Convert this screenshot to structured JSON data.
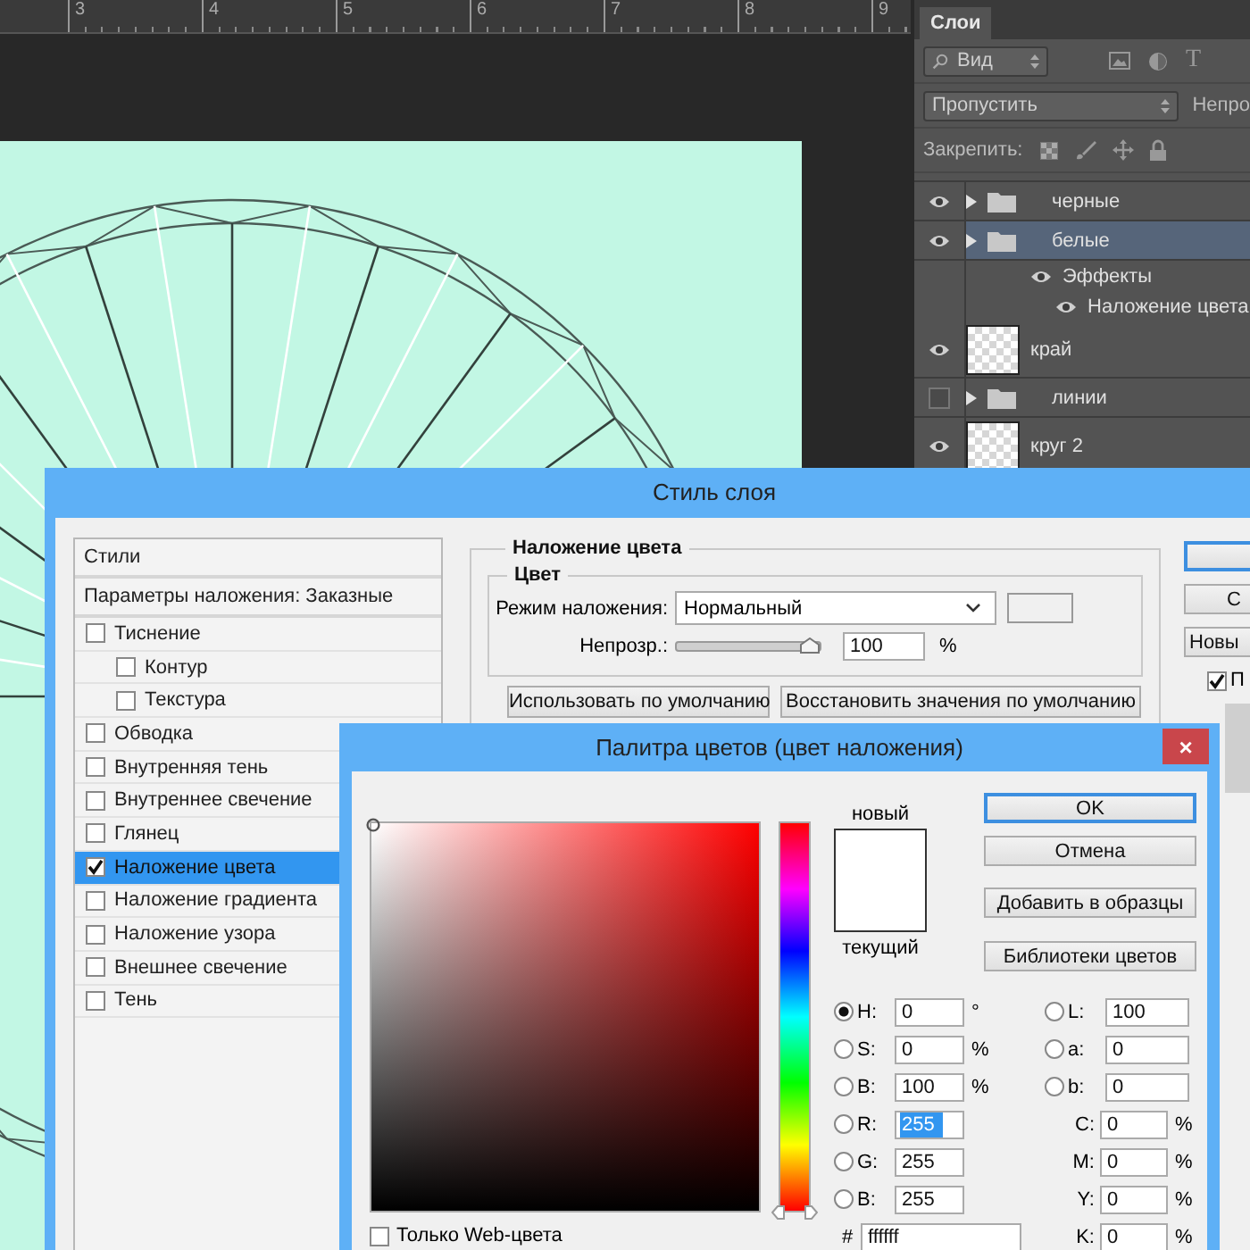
{
  "ruler": {
    "ticks": [
      "3",
      "4",
      "5",
      "6",
      "7",
      "8",
      "9"
    ]
  },
  "layers_panel": {
    "tab": "Слои",
    "filter": "Вид",
    "type_filter": "T",
    "blend_mode": "Пропустить",
    "opacity_label": "Непро",
    "lock_label": "Закрепить:",
    "layers": [
      {
        "kind": "group",
        "name": "черные",
        "visible": true,
        "selected": false
      },
      {
        "kind": "group",
        "name": "белые",
        "visible": true,
        "selected": true,
        "children": [
          {
            "kind": "effects",
            "name": "Эффекты",
            "visible": true,
            "children": [
              {
                "kind": "effects",
                "name": "Наложение цвета",
                "visible": true
              }
            ]
          }
        ]
      },
      {
        "kind": "layer",
        "name": "край",
        "visible": true,
        "selected": false
      },
      {
        "kind": "group",
        "name": "линии",
        "visible": false,
        "selected": false
      },
      {
        "kind": "layer",
        "name": "круг 2",
        "visible": true,
        "selected": false
      }
    ]
  },
  "layer_style": {
    "title": "Стиль слоя",
    "styles_header": "Стили",
    "blending_options": "Параметры наложения: Заказные",
    "styles": [
      {
        "label": "Тиснение",
        "checked": false,
        "selected": false,
        "children": [
          {
            "label": "Контур",
            "checked": false,
            "selected": false
          },
          {
            "label": "Текстура",
            "checked": false,
            "selected": false
          }
        ]
      },
      {
        "label": "Обводка",
        "checked": false,
        "selected": false
      },
      {
        "label": "Внутренняя тень",
        "checked": false,
        "selected": false
      },
      {
        "label": "Внутреннее свечение",
        "checked": false,
        "selected": false
      },
      {
        "label": "Глянец",
        "checked": false,
        "selected": false
      },
      {
        "label": "Наложение цвета",
        "checked": true,
        "selected": true
      },
      {
        "label": "Наложение градиента",
        "checked": false,
        "selected": false
      },
      {
        "label": "Наложение узора",
        "checked": false,
        "selected": false
      },
      {
        "label": "Внешнее свечение",
        "checked": false,
        "selected": false
      },
      {
        "label": "Тень",
        "checked": false,
        "selected": false
      }
    ],
    "section_title": "Наложение цвета",
    "group_title": "Цвет",
    "blend_mode_label": "Режим наложения:",
    "blend_mode": "Нормальный",
    "opacity_label": "Непрозр.:",
    "opacity": {
      "level": 1
    },
    "opacity_value": "100",
    "opacity_unit": "%",
    "buttons": [
      "Использовать по умолчанию",
      "Восстановить значения по умолчанию"
    ],
    "side_buttons": [
      {
        "default": true
      },
      {
        "label": "С",
        "default": false
      },
      {
        "label": "Новы",
        "default": false
      }
    ],
    "side_checkbox": {
      "label": "П",
      "checked": true
    }
  },
  "color_picker": {
    "title": "Палитра цветов (цвет наложения)",
    "close": "×",
    "new_label": "новый",
    "current_label": "текущий",
    "hue": {
      "level": 0
    },
    "buttons": [
      {
        "label": "OK",
        "default": true
      },
      {
        "label": "Отмена",
        "default": false
      },
      {
        "label": "Добавить в образцы",
        "default": false
      },
      {
        "label": "Библиотеки цветов",
        "default": false
      }
    ],
    "hsb": [
      {
        "label": "H:",
        "value": "0",
        "unit": "°",
        "selected": true
      },
      {
        "label": "S:",
        "value": "0",
        "unit": "%",
        "selected": false
      },
      {
        "label": "B:",
        "value": "100",
        "unit": "%",
        "selected": false
      }
    ],
    "rgb": [
      {
        "label": "R:",
        "value": "255",
        "selected": false,
        "highlighted": true
      },
      {
        "label": "G:",
        "value": "255",
        "selected": false,
        "highlighted": false
      },
      {
        "label": "B:",
        "value": "255",
        "selected": false,
        "highlighted": false
      }
    ],
    "lab": [
      {
        "label": "L:",
        "value": "100",
        "selected": false
      },
      {
        "label": "a:",
        "value": "0",
        "selected": false
      },
      {
        "label": "b:",
        "value": "0",
        "selected": false
      }
    ],
    "cmyk": [
      {
        "label": "C:",
        "value": "0",
        "unit": "%"
      },
      {
        "label": "M:",
        "value": "0",
        "unit": "%"
      },
      {
        "label": "Y:",
        "value": "0",
        "unit": "%"
      },
      {
        "label": "K:",
        "value": "0",
        "unit": "%"
      }
    ],
    "hex_label": "#",
    "hex": "ffffff",
    "web_only": {
      "label": "Только Web-цвета",
      "checked": false
    }
  }
}
